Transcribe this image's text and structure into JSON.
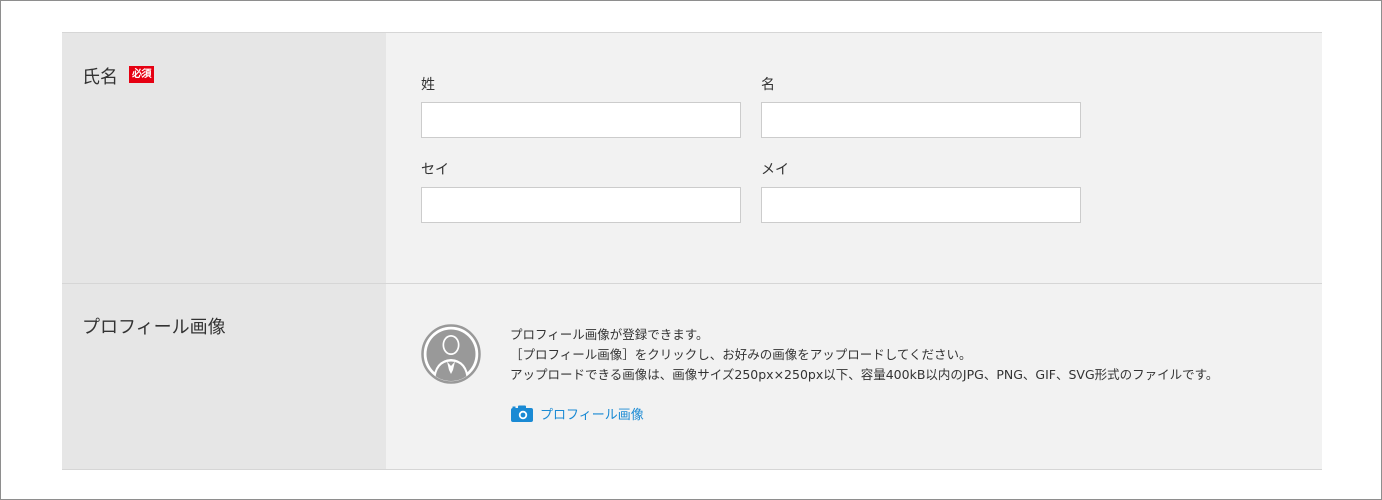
{
  "form": {
    "name_row": {
      "label": "氏名",
      "required_badge": "必須",
      "fields": {
        "last_name": {
          "label": "姓",
          "value": "",
          "placeholder": ""
        },
        "first_name": {
          "label": "名",
          "value": "",
          "placeholder": ""
        },
        "last_name_kana": {
          "label": "セイ",
          "value": "",
          "placeholder": ""
        },
        "first_name_kana": {
          "label": "メイ",
          "value": "",
          "placeholder": ""
        }
      }
    },
    "profile_row": {
      "label": "プロフィール画像",
      "avatar_icon": "person-avatar-icon",
      "description": [
        "プロフィール画像が登録できます。",
        "［プロフィール画像］をクリックし、お好みの画像をアップロードしてください。",
        "アップロードできる画像は、画像サイズ250px×250px以下、容量400kB以内のJPG、PNG、GIF、SVG形式のファイルです。"
      ],
      "upload_link": {
        "label": "プロフィール画像",
        "icon": "camera-icon"
      }
    }
  },
  "colors": {
    "required_badge": "#e60012",
    "link": "#1a8ad4",
    "label_bg": "#e6e6e6",
    "value_bg": "#f2f2f2",
    "avatar": "#999999"
  }
}
